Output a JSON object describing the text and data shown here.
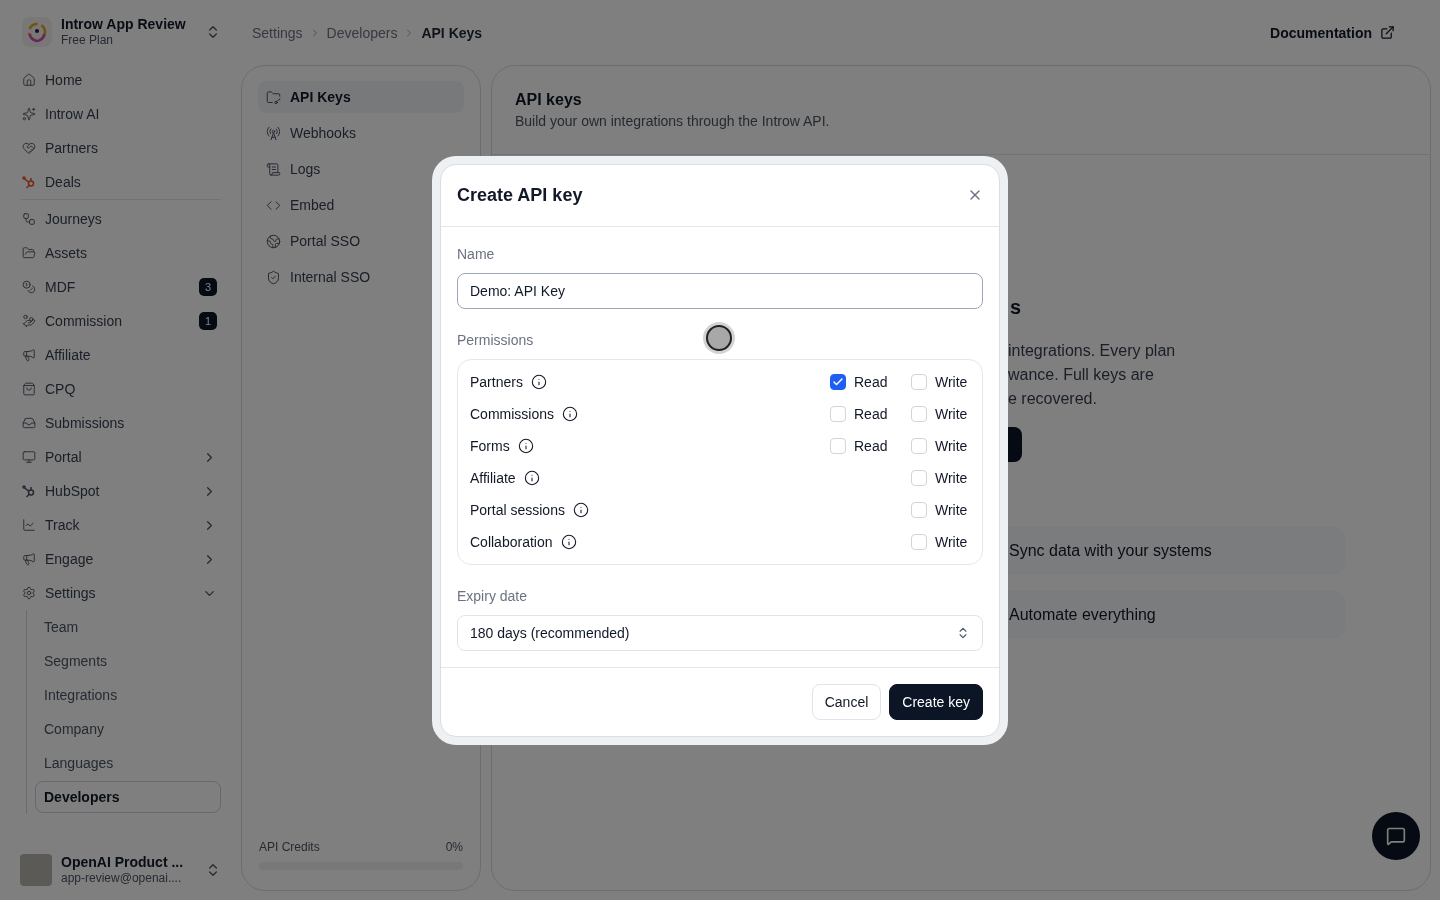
{
  "workspace": {
    "name": "Introw App Review",
    "plan": "Free Plan"
  },
  "breadcrumb": [
    {
      "label": "Settings",
      "current": false
    },
    {
      "label": "Developers",
      "current": false
    },
    {
      "label": "API Keys",
      "current": true
    }
  ],
  "documentation_link": "Documentation",
  "sidebar": {
    "sections": [
      {
        "items": [
          {
            "label": "Home"
          },
          {
            "label": "Introw AI"
          },
          {
            "label": "Partners"
          },
          {
            "label": "Deals"
          }
        ]
      },
      {
        "items": [
          {
            "label": "Journeys"
          },
          {
            "label": "Assets"
          },
          {
            "label": "MDF",
            "badge": "3"
          },
          {
            "label": "Commission",
            "badge": "1"
          },
          {
            "label": "Affiliate"
          },
          {
            "label": "CPQ"
          },
          {
            "label": "Submissions"
          },
          {
            "label": "Portal",
            "expanded": false
          },
          {
            "label": "HubSpot",
            "expanded": false
          },
          {
            "label": "Track",
            "expanded": false
          },
          {
            "label": "Engage",
            "expanded": false
          },
          {
            "label": "Settings",
            "expanded": true,
            "children": [
              {
                "label": "Team",
                "selected": false
              },
              {
                "label": "Segments",
                "selected": false
              },
              {
                "label": "Integrations",
                "selected": false
              },
              {
                "label": "Company",
                "selected": false
              },
              {
                "label": "Languages",
                "selected": false
              },
              {
                "label": "Developers",
                "selected": true
              }
            ]
          }
        ]
      }
    ],
    "user": {
      "name": "OpenAI Product ...",
      "email": "app-review@openai...."
    }
  },
  "settings_nav": {
    "items": [
      {
        "label": "API Keys",
        "selected": true
      },
      {
        "label": "Webhooks",
        "selected": false
      },
      {
        "label": "Logs",
        "selected": false
      },
      {
        "label": "Embed",
        "selected": false
      },
      {
        "label": "Portal SSO",
        "selected": false
      },
      {
        "label": "Internal SSO",
        "selected": false
      }
    ],
    "credits": {
      "label": "API Credits",
      "value": "0%",
      "level": 0
    }
  },
  "main": {
    "title": "API keys",
    "subtitle": "Build your own integrations through the Introw API.",
    "heading_fragment": "s",
    "text_lines": [
      "integrations. Every plan",
      "wance. Full keys are",
      "e recovered."
    ],
    "features": [
      "Sync data with your systems",
      "Automate everything"
    ]
  },
  "dialog": {
    "title": "Create API key",
    "name_field": {
      "label": "Name",
      "value": "Demo: API Key"
    },
    "permissions": {
      "label": "Permissions",
      "rows": [
        {
          "name": "Partners",
          "read": {
            "label": "Read",
            "checked": true
          },
          "write": {
            "label": "Write",
            "checked": false
          }
        },
        {
          "name": "Commissions",
          "read": {
            "label": "Read",
            "checked": false
          },
          "write": {
            "label": "Write",
            "checked": false
          }
        },
        {
          "name": "Forms",
          "read": {
            "label": "Read",
            "checked": false
          },
          "write": {
            "label": "Write",
            "checked": false
          }
        },
        {
          "name": "Affiliate",
          "write": {
            "label": "Write",
            "checked": false
          }
        },
        {
          "name": "Portal sessions",
          "write": {
            "label": "Write",
            "checked": false
          }
        },
        {
          "name": "Collaboration",
          "write": {
            "label": "Write",
            "checked": false
          }
        }
      ]
    },
    "expiry": {
      "label": "Expiry date",
      "value": "180 days (recommended)"
    },
    "buttons": [
      {
        "label": "Cancel",
        "kind": "secondary"
      },
      {
        "label": "Create key",
        "kind": "primary"
      }
    ]
  }
}
